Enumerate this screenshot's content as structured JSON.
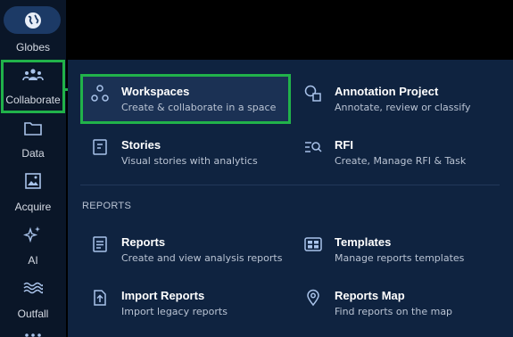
{
  "sidebar": {
    "items": [
      {
        "label": "Globes",
        "icon": "globe-icon"
      },
      {
        "label": "Collaborate",
        "icon": "people-group-icon"
      },
      {
        "label": "Data",
        "icon": "folder-icon"
      },
      {
        "label": "Acquire",
        "icon": "image-icon"
      },
      {
        "label": "AI",
        "icon": "sparkle-icon"
      },
      {
        "label": "Outfall",
        "icon": "waves-icon"
      }
    ]
  },
  "menu": {
    "items": [
      {
        "title": "Workspaces",
        "desc": "Create & collaborate in a space",
        "icon": "nodes-icon"
      },
      {
        "title": "Annotation Project",
        "desc": "Annotate, review or classify",
        "icon": "shapes-icon"
      },
      {
        "title": "Stories",
        "desc": "Visual stories with analytics",
        "icon": "document-lines-icon"
      },
      {
        "title": "RFI",
        "desc": "Create, Manage RFI & Task",
        "icon": "search-list-icon"
      }
    ],
    "section_label": "REPORTS",
    "report_items": [
      {
        "title": "Reports",
        "desc": "Create and view analysis reports",
        "icon": "report-icon"
      },
      {
        "title": "Templates",
        "desc": "Manage reports templates",
        "icon": "template-icon"
      },
      {
        "title": "Import Reports",
        "desc": "Import legacy reports",
        "icon": "upload-file-icon"
      },
      {
        "title": "Reports Map",
        "desc": "Find reports on the map",
        "icon": "map-pin-icon"
      }
    ]
  },
  "colors": {
    "highlight": "#21b24a",
    "panel": "#0f2340",
    "sidebar": "#0a1628",
    "icon": "#a9c3ea"
  }
}
